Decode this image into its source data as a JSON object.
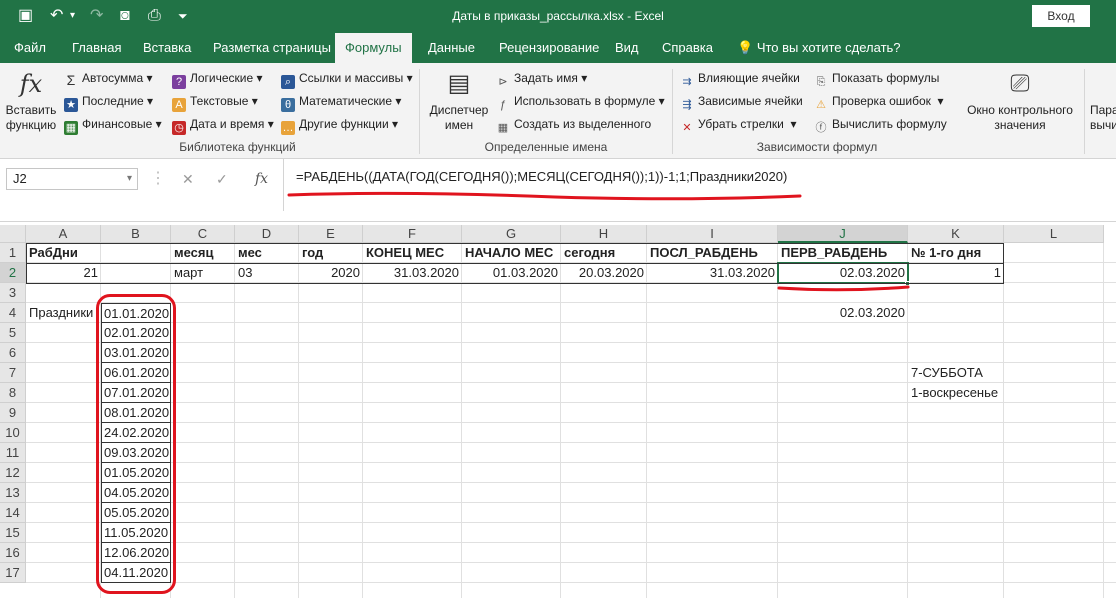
{
  "window": {
    "title": "Даты в приказы_рассылка.xlsx  -  Excel",
    "login_button": "Вход"
  },
  "ribbon_tabs": [
    "Файл",
    "Главная",
    "Вставка",
    "Разметка страницы",
    "Формулы",
    "Данные",
    "Рецензирование",
    "Вид",
    "Справка"
  ],
  "tell_me": "Что вы хотите сделать?",
  "active_tab": "Формулы",
  "ribbon": {
    "insert_function": [
      "Вставить",
      "функцию"
    ],
    "library": {
      "autosum": "Автосумма",
      "recent": "Последние",
      "financial": "Финансовые",
      "logical": "Логические",
      "text": "Текстовые",
      "datetime": "Дата и время",
      "lookup": "Ссылки и массивы",
      "math": "Математические",
      "other": "Другие функции",
      "label": "Библиотека функций"
    },
    "names": {
      "manager": [
        "Диспетчер",
        "имен"
      ],
      "define": "Задать имя",
      "use_in_formula": "Использовать в формуле",
      "create_from_selection": "Создать из выделенного",
      "label": "Определенные имена"
    },
    "auditing": {
      "precedents": "Влияющие ячейки",
      "dependents": "Зависимые ячейки",
      "remove_arrows": "Убрать стрелки",
      "show_formulas": "Показать формулы",
      "error_checking": "Проверка ошибок",
      "evaluate": "Вычислить формулу",
      "label": "Зависимости формул"
    },
    "watch": [
      "Окно контрольного",
      "значения"
    ],
    "calc_partial": [
      "Пара",
      "вычи"
    ]
  },
  "name_box": "J2",
  "formula": "=РАБДЕНЬ((ДАТА(ГОД(СЕГОДНЯ());МЕСЯЦ(СЕГОДНЯ());1))-1;1;Праздники2020)",
  "columns": [
    "A",
    "B",
    "C",
    "D",
    "E",
    "F",
    "G",
    "H",
    "I",
    "J",
    "K",
    "L"
  ],
  "rows": [
    "1",
    "2",
    "3",
    "4",
    "5",
    "6",
    "7",
    "8",
    "9",
    "10",
    "11",
    "12",
    "13",
    "14",
    "15",
    "16",
    "17"
  ],
  "headers_row1": {
    "A": "РабДни",
    "C": "месяц",
    "D": "мес",
    "E": "год",
    "F": "КОНЕЦ МЕС",
    "G": "НАЧАЛО МЕС",
    "H": "сегодня",
    "I": "ПОСЛ_РАБДЕНЬ",
    "J": "ПЕРВ_РАБДЕНЬ",
    "K": "№ 1-го дня"
  },
  "values_row2": {
    "A": "21",
    "C": "март",
    "D": "03",
    "E": "2020",
    "F": "31.03.2020",
    "G": "01.03.2020",
    "H": "20.03.2020",
    "I": "31.03.2020",
    "J": "02.03.2020",
    "K": "1"
  },
  "holidays_label": "Праздники",
  "holidays": [
    "01.01.2020",
    "02.01.2020",
    "03.01.2020",
    "06.01.2020",
    "07.01.2020",
    "08.01.2020",
    "24.02.2020",
    "09.03.2020",
    "01.05.2020",
    "04.05.2020",
    "05.05.2020",
    "11.05.2020",
    "12.06.2020",
    "04.11.2020"
  ],
  "j4": "02.03.2020",
  "k7": "7-СУББОТА",
  "k8": "1-воскресенье",
  "annotation_color": "#e0141e",
  "accent_color": "#217346"
}
